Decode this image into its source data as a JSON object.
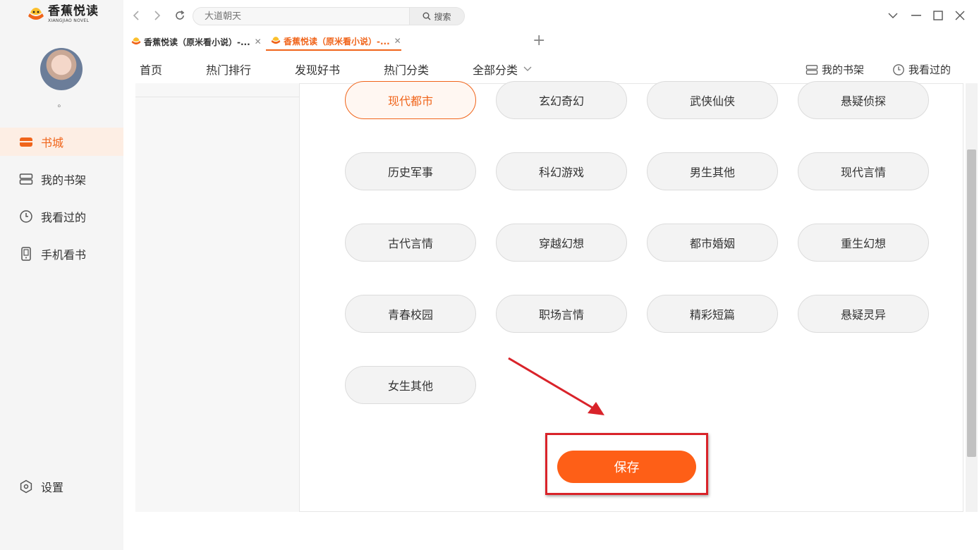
{
  "app": {
    "logo_cn": "香蕉悦读",
    "logo_en": "XIANGJIAO NOVEL",
    "accent": "#f0641a"
  },
  "user": {
    "name": "。"
  },
  "sidebar": {
    "items": [
      {
        "label": "书城",
        "icon": "store-icon",
        "active": true
      },
      {
        "label": "我的书架",
        "icon": "bookshelf-icon"
      },
      {
        "label": "我看过的",
        "icon": "clock-icon"
      },
      {
        "label": "手机看书",
        "icon": "phone-icon"
      }
    ],
    "settings_label": "设置"
  },
  "browser": {
    "address_placeholder": "大道朝天",
    "search_label": "搜索",
    "tabs": [
      {
        "label": "香蕉悦读（原米看小说）-...",
        "active": false
      },
      {
        "label": "香蕉悦读（原米看小说）-...",
        "active": true
      }
    ]
  },
  "menu": {
    "items": [
      "首页",
      "热门排行",
      "发现好书",
      "热门分类",
      "全部分类"
    ],
    "right": [
      "我的书架",
      "我看过的"
    ]
  },
  "categories": [
    {
      "label": "现代都市",
      "selected": true
    },
    {
      "label": "玄幻奇幻"
    },
    {
      "label": "武侠仙侠"
    },
    {
      "label": "悬疑侦探"
    },
    {
      "label": "历史军事"
    },
    {
      "label": "科幻游戏"
    },
    {
      "label": "男生其他"
    },
    {
      "label": "现代言情"
    },
    {
      "label": "古代言情"
    },
    {
      "label": "穿越幻想"
    },
    {
      "label": "都市婚姻"
    },
    {
      "label": "重生幻想"
    },
    {
      "label": "青春校园"
    },
    {
      "label": "职场言情"
    },
    {
      "label": "精彩短篇"
    },
    {
      "label": "悬疑灵异"
    },
    {
      "label": "女生其他"
    }
  ],
  "save_label": "保存",
  "colors": {
    "save_button": "#fe5f17",
    "annotation": "#d9232a"
  }
}
